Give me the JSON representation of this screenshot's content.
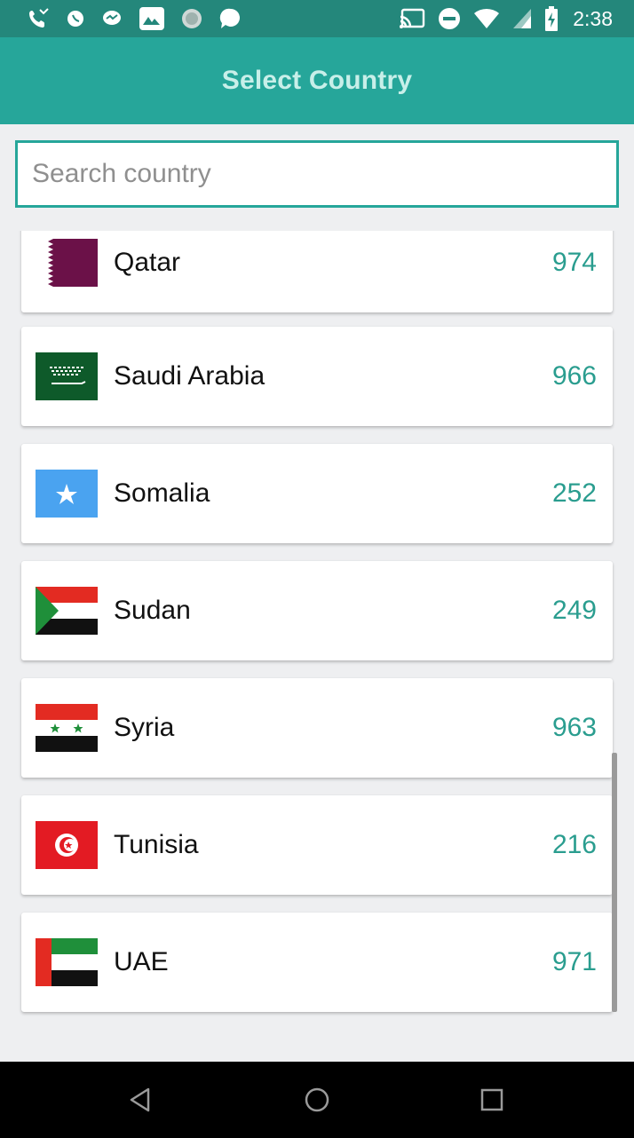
{
  "status_bar": {
    "time": "2:38",
    "left_icons": [
      "missed-call-icon",
      "whatsapp-icon",
      "messenger-icon",
      "photos-icon",
      "sphere-icon",
      "chat-bubble-icon"
    ],
    "right_icons": [
      "cast-icon",
      "do-not-disturb-icon",
      "wifi-icon",
      "signal-icon",
      "battery-charging-icon"
    ]
  },
  "app_bar": {
    "title": "Select Country"
  },
  "search": {
    "placeholder": "Search country",
    "value": ""
  },
  "countries": [
    {
      "name": "Qatar",
      "code": "974",
      "flag": "qatar-flag-icon"
    },
    {
      "name": "Saudi Arabia",
      "code": "966",
      "flag": "saudi-arabia-flag-icon"
    },
    {
      "name": "Somalia",
      "code": "252",
      "flag": "somalia-flag-icon"
    },
    {
      "name": "Sudan",
      "code": "249",
      "flag": "sudan-flag-icon"
    },
    {
      "name": "Syria",
      "code": "963",
      "flag": "syria-flag-icon"
    },
    {
      "name": "Tunisia",
      "code": "216",
      "flag": "tunisia-flag-icon"
    },
    {
      "name": "UAE",
      "code": "971",
      "flag": "uae-flag-icon"
    }
  ],
  "nav_bar": {
    "buttons": [
      "back-icon",
      "home-icon",
      "recents-icon"
    ]
  },
  "colors": {
    "status_bar": "#24877b",
    "app_bar": "#26a69a",
    "accent": "#26a69a",
    "code_text": "#2a9d8f",
    "title_text": "#c8efe9"
  }
}
